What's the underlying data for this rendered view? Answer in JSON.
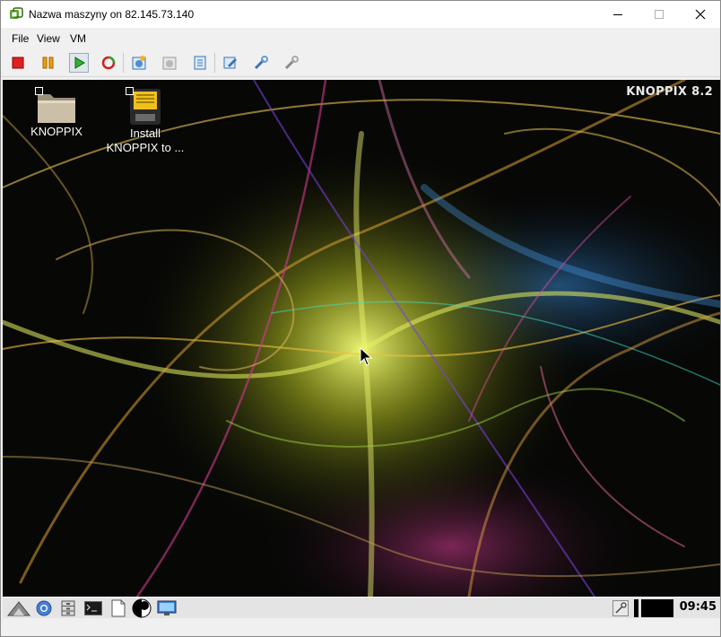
{
  "window": {
    "title": "Nazwa maszyny on 82.145.73.140"
  },
  "menu": {
    "file": "File",
    "view": "View",
    "vm": "VM"
  },
  "toolbar": {
    "icons": [
      "stop-icon",
      "pause-icon",
      "start-icon",
      "reset-icon",
      "snapshot-icon",
      "revert-icon",
      "manage-snapshots-icon",
      "settings-icon",
      "tools-icon",
      "toolbox-icon"
    ]
  },
  "guest": {
    "brand": "KNOPPIX 8.2",
    "desktop_icons": [
      {
        "label": "KNOPPIX",
        "icon": "folder-icon"
      },
      {
        "label": "Install\nKNOPPIX to ...",
        "icon": "install-drive-icon"
      }
    ],
    "clock": "09:45",
    "colors": {
      "taskbar": "#e4e4e4",
      "desktop": "#070806"
    }
  }
}
